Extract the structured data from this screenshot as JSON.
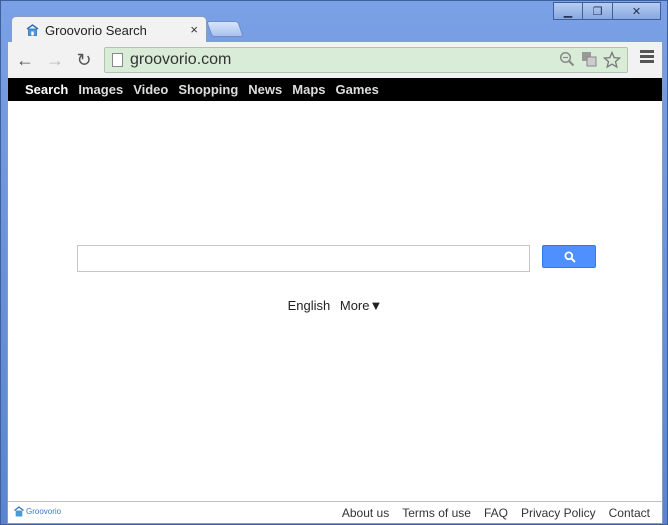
{
  "browser": {
    "tab_title": "Groovorio Search",
    "tab_close": "×",
    "url": "groovorio.com",
    "back": "←",
    "forward": "→",
    "reload": "↻",
    "window_controls": {
      "minimize": "▁",
      "maximize": "❐",
      "close": "✕"
    },
    "omnibox_icons": [
      "zoom-icon",
      "translate-icon",
      "bookmark-star-icon"
    ]
  },
  "topnav": {
    "items": [
      "Search",
      "Images",
      "Video",
      "Shopping",
      "News",
      "Maps",
      "Games"
    ],
    "active": "Search"
  },
  "search": {
    "value": "",
    "placeholder": ""
  },
  "language": {
    "current": "English",
    "more": "More▼"
  },
  "footer": {
    "logo_text": "Groovorio",
    "links": [
      "About us",
      "Terms of use",
      "FAQ",
      "Privacy Policy",
      "Contact"
    ]
  },
  "colors": {
    "omnibox_bg": "#d8ecd7",
    "topnav_bg": "#000000",
    "search_button": "#4d90fe"
  }
}
